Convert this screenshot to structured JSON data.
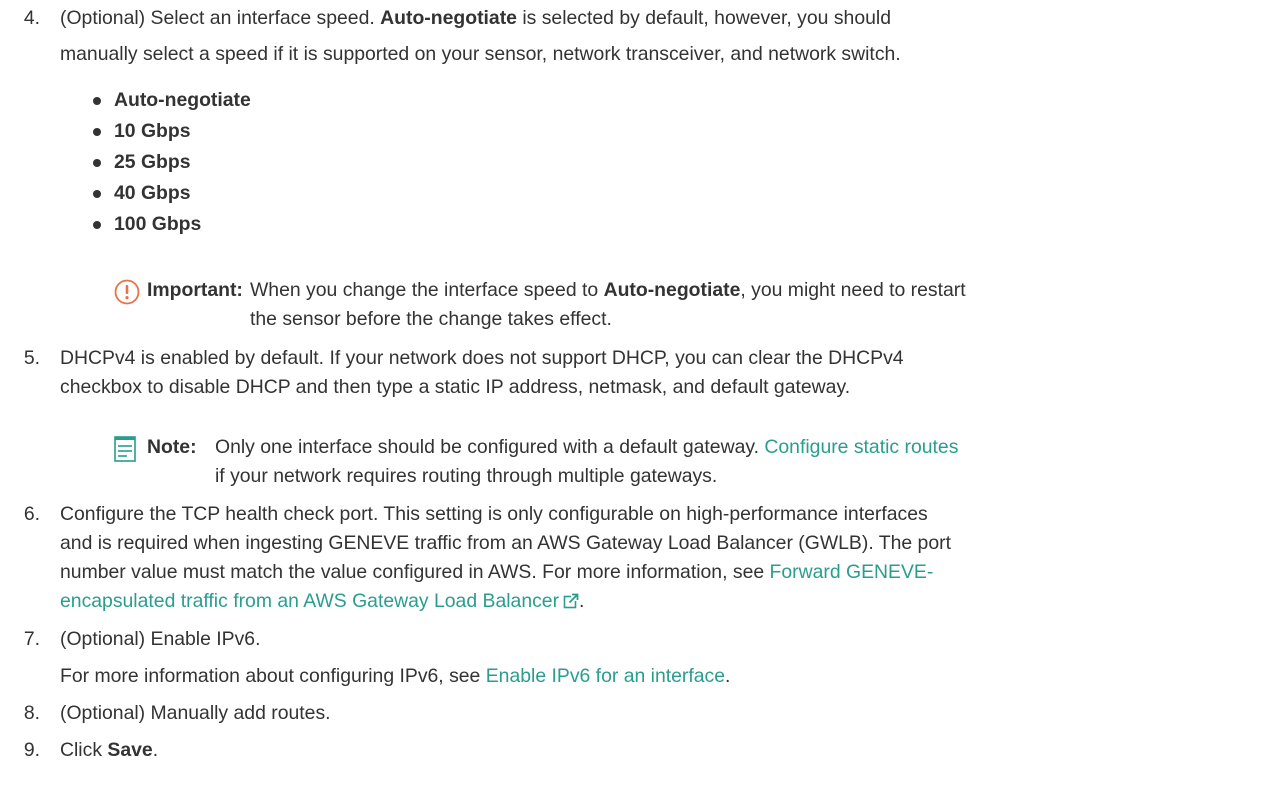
{
  "steps": {
    "s4": {
      "number": "4.",
      "line1_a": "(Optional) Select an interface speed. ",
      "line1_bold": "Auto-negotiate",
      "line1_b": " is selected by default, however, you should",
      "line2": "manually select a speed if it is supported on your sensor, network transceiver, and network switch.",
      "options": [
        "Auto-negotiate",
        "10 Gbps",
        "25 Gbps",
        "40 Gbps",
        "100 Gbps"
      ],
      "important": {
        "label": "Important:",
        "line1_a": "When you change the interface speed to ",
        "line1_bold": "Auto-negotiate",
        "line1_b": ", you might need to restart",
        "line2": "the sensor before the change takes effect."
      }
    },
    "s5": {
      "number": "5.",
      "line1": "DHCPv4 is enabled by default. If your network does not support DHCP, you can clear the DHCPv4",
      "line2": "checkbox to disable DHCP and then type a static IP address, netmask, and default gateway.",
      "note": {
        "label": "Note:",
        "line1": "Only one interface should be configured with a default gateway.",
        "link": "Configure static routes",
        "line2": "if your network requires routing through multiple gateways."
      }
    },
    "s6": {
      "number": "6.",
      "line1": "Configure the TCP health check port. This setting is only configurable on high-performance interfaces",
      "line2": "and is required when ingesting GENEVE traffic from an AWS Gateway Load Balancer (GWLB). The port",
      "line3": "number value must match the value configured in AWS. For more information, see",
      "link_part1": "Forward GENEVE-",
      "link_part2": "encapsulated traffic from an AWS Gateway Load Balancer",
      "after_link": "."
    },
    "s7": {
      "number": "7.",
      "line1": "(Optional) Enable IPv6.",
      "line2_a": "For more information about configuring IPv6, see ",
      "link": "Enable IPv6 for an interface",
      "line2_b": "."
    },
    "s8": {
      "number": "8.",
      "line1": "(Optional) Manually add routes."
    },
    "s9": {
      "number": "9.",
      "line1_a": "Click ",
      "line1_bold": "Save",
      "line1_b": "."
    }
  },
  "colors": {
    "text": "#333333",
    "link": "#2a9d8f",
    "important_icon": "#e8734a",
    "note_icon": "#2a9d8f"
  },
  "icons": {
    "important": "exclamation-circle-icon",
    "note": "note-lines-icon",
    "external": "external-link-icon"
  }
}
